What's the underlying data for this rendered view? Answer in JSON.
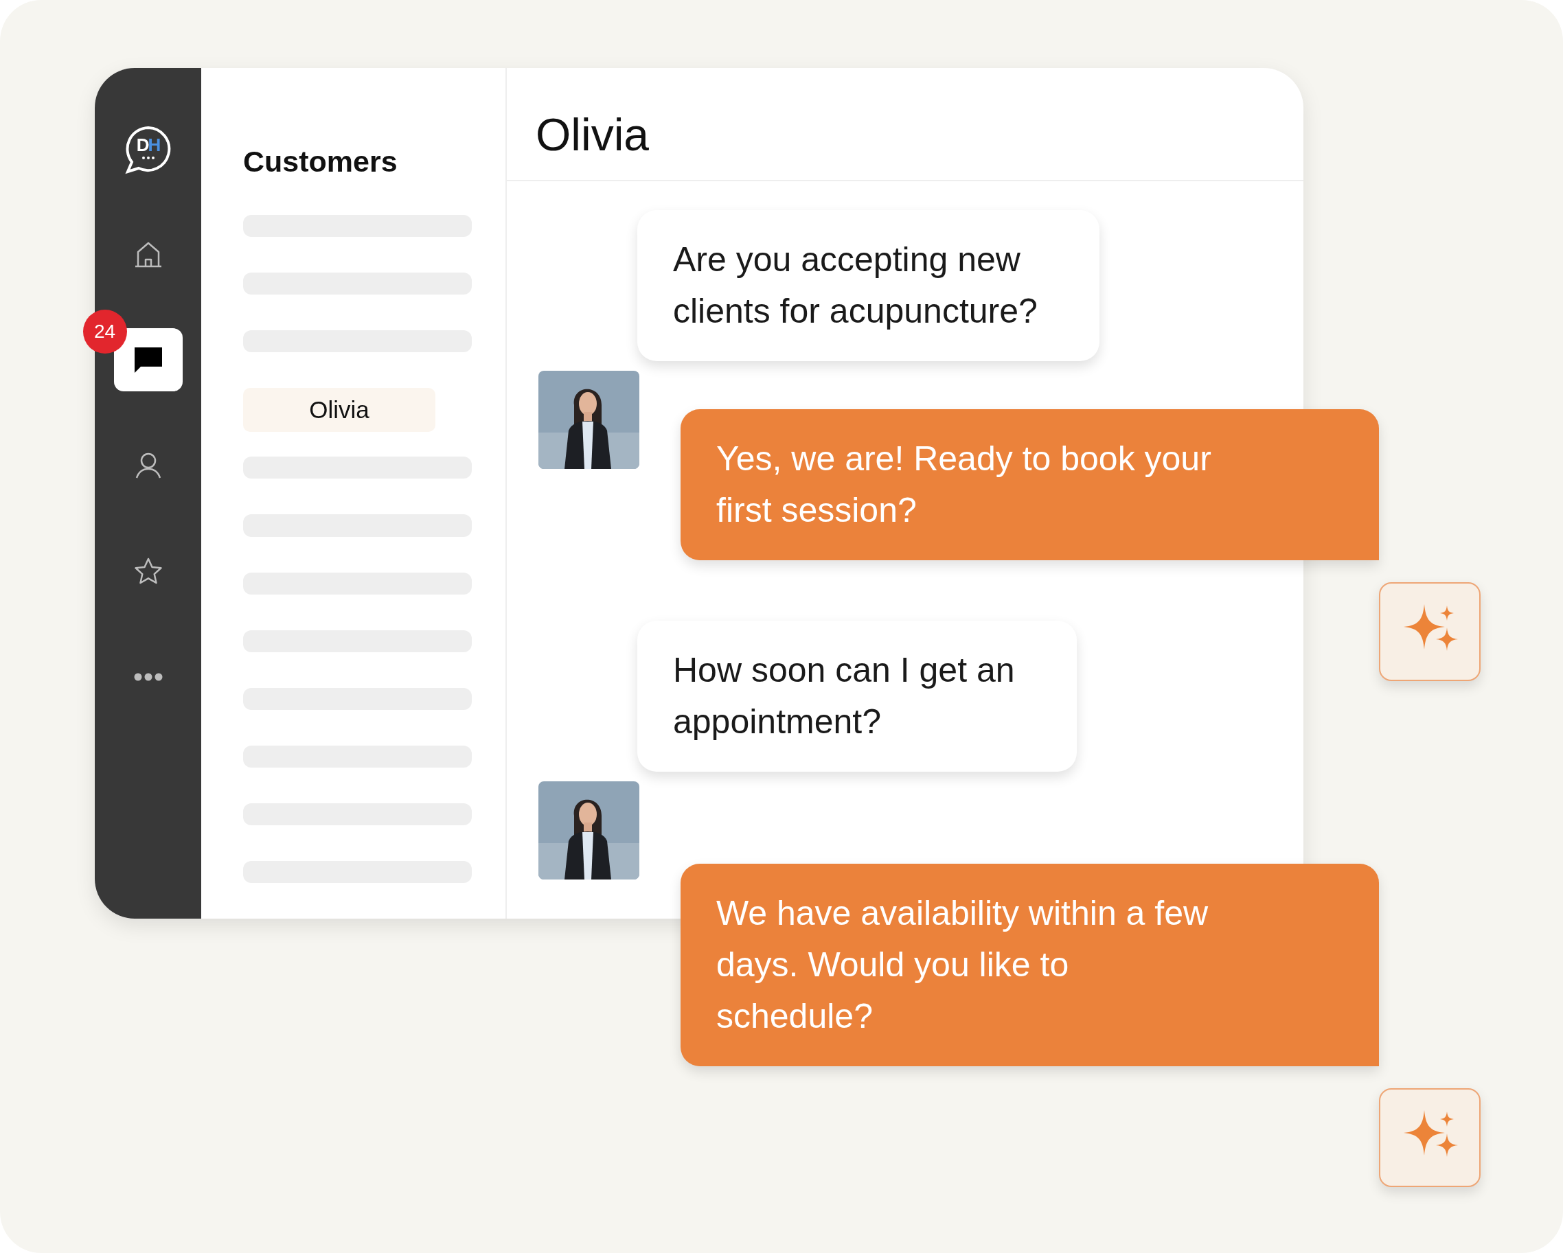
{
  "logo": {
    "text": "DH"
  },
  "nav": [
    {
      "kind": "home",
      "selected": false
    },
    {
      "kind": "chat",
      "selected": true,
      "badge": "24"
    },
    {
      "kind": "person",
      "selected": false
    },
    {
      "kind": "star",
      "selected": false
    },
    {
      "kind": "more",
      "selected": false
    }
  ],
  "customers": {
    "title": "Customers",
    "items": [
      {
        "kind": "skeleton"
      },
      {
        "kind": "skeleton"
      },
      {
        "kind": "skeleton"
      },
      {
        "kind": "contact",
        "name": "Olivia",
        "selected": true
      },
      {
        "kind": "skeleton"
      },
      {
        "kind": "skeleton"
      },
      {
        "kind": "skeleton"
      },
      {
        "kind": "skeleton"
      },
      {
        "kind": "skeleton"
      },
      {
        "kind": "skeleton"
      },
      {
        "kind": "skeleton"
      },
      {
        "kind": "skeleton"
      }
    ]
  },
  "chat": {
    "title": "Olivia",
    "messages": [
      {
        "kind": "received",
        "lines": [
          "Are you accepting new",
          "clients for acupuncture?"
        ]
      },
      {
        "kind": "sent",
        "lines": [
          "Yes, we are! Ready to book your",
          "first session?"
        ]
      },
      {
        "kind": "received",
        "lines": [
          "How soon can I get an",
          "appointment?"
        ]
      },
      {
        "kind": "sent",
        "lines": [
          "We have availability within a few",
          "days. Would you like to",
          "schedule?"
        ]
      }
    ]
  }
}
